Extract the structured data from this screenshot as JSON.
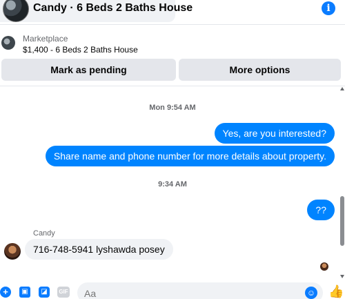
{
  "header": {
    "title": "Candy · 6 Beds 2 Baths House",
    "info_icon": "info-icon"
  },
  "marketplace": {
    "label": "Marketplace",
    "listing": "$1,400 - 6 Beds 2 Baths House"
  },
  "actions": {
    "pending_label": "Mark as pending",
    "more_label": "More options"
  },
  "conversation": {
    "timestamp_1": "Mon 9:54 AM",
    "outgoing_1": "Yes, are you interested?",
    "outgoing_2": "Share name and phone number for more details about property.",
    "timestamp_2": "9:34 AM",
    "outgoing_3": "??",
    "sender_name": "Candy",
    "incoming_1": "716-748-5941 lyshawda posey"
  },
  "composer": {
    "placeholder": "Aa",
    "icons": [
      "plus-icon",
      "photo-icon",
      "sticker-icon",
      "gif-icon",
      "emoji-icon",
      "thumbs-up-icon"
    ]
  },
  "colors": {
    "accent": "#0084ff",
    "incoming_bubble": "#f0f2f5",
    "button_bg": "#e4e6eb"
  }
}
